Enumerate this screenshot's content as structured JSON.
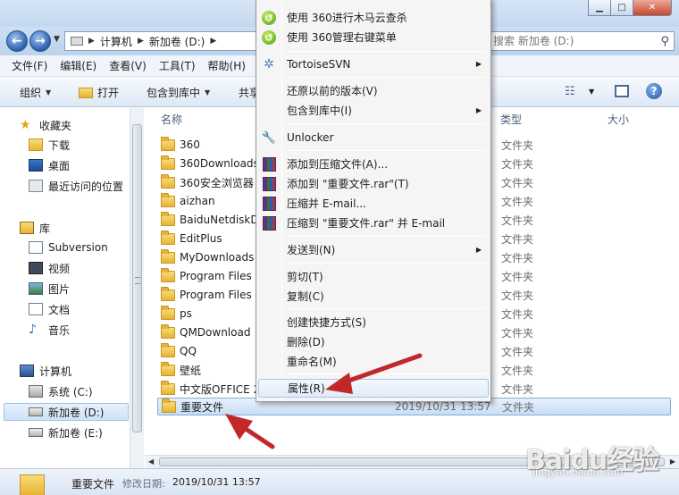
{
  "address": {
    "crumbs": [
      "计算机",
      "新加卷 (D:)"
    ],
    "search_placeholder": "搜索 新加卷 (D:)"
  },
  "menubar": [
    "文件(F)",
    "编辑(E)",
    "查看(V)",
    "工具(T)",
    "帮助(H)"
  ],
  "commandbar": {
    "organize": "组织",
    "open": "打开",
    "include_in_library": "包含到库中",
    "share": "共享"
  },
  "navpane": {
    "favorites": "收藏夹",
    "downloads": "下载",
    "desktop": "桌面",
    "recent": "最近访问的位置",
    "libraries": "库",
    "subversion": "Subversion",
    "videos": "视频",
    "pictures": "图片",
    "documents": "文档",
    "music": "音乐",
    "computer": "计算机",
    "drive_c": "系统 (C:)",
    "drive_d": "新加卷 (D:)",
    "drive_e": "新加卷 (E:)"
  },
  "filelist": {
    "columns": {
      "name": "名称",
      "type": "类型",
      "size": "大小"
    },
    "rows": [
      {
        "name": "360",
        "type": "文件夹"
      },
      {
        "name": "360Downloads",
        "type": "文件夹"
      },
      {
        "name": "360安全浏览器",
        "type": "文件夹"
      },
      {
        "name": "aizhan",
        "type": "文件夹"
      },
      {
        "name": "BaiduNetdiskD",
        "type": "文件夹"
      },
      {
        "name": "EditPlus",
        "type": "文件夹"
      },
      {
        "name": "MyDownloads",
        "type": "文件夹"
      },
      {
        "name": "Program Files",
        "type": "文件夹"
      },
      {
        "name": "Program Files",
        "type": "文件夹"
      },
      {
        "name": "ps",
        "type": "文件夹"
      },
      {
        "name": "QMDownload",
        "type": "文件夹"
      },
      {
        "name": "QQ",
        "type": "文件夹"
      },
      {
        "name": "壁纸",
        "type": "文件夹"
      },
      {
        "name": "中文版OFFICE 2",
        "type": "文件夹"
      },
      {
        "name": "重要文件",
        "date": "2019/10/31 13:57",
        "type": "文件夹"
      }
    ]
  },
  "context_menu": {
    "items": [
      {
        "label": "使用 360进行木马云查杀",
        "icon": "360-icon"
      },
      {
        "label": "使用 360管理右键菜单",
        "icon": "360-icon"
      },
      {
        "label": "TortoiseSVN",
        "icon": "tortoisesvn-icon",
        "submenu": true
      },
      {
        "label": "还原以前的版本(V)"
      },
      {
        "label": "包含到库中(I)",
        "submenu": true
      },
      {
        "label": "Unlocker",
        "icon": "unlocker-icon"
      },
      {
        "label": "添加到压缩文件(A)...",
        "icon": "winrar-icon"
      },
      {
        "label": "添加到 \"重要文件.rar\"(T)",
        "icon": "winrar-icon"
      },
      {
        "label": "压缩并 E-mail...",
        "icon": "winrar-icon"
      },
      {
        "label": "压缩到 \"重要文件.rar\" 并 E-mail",
        "icon": "winrar-icon"
      },
      {
        "label": "发送到(N)",
        "submenu": true
      },
      {
        "label": "剪切(T)"
      },
      {
        "label": "复制(C)"
      },
      {
        "label": "创建快捷方式(S)"
      },
      {
        "label": "删除(D)"
      },
      {
        "label": "重命名(M)"
      },
      {
        "label": "属性(R)"
      }
    ]
  },
  "details": {
    "name": "重要文件",
    "date_label": "修改日期:",
    "date": "2019/10/31 13:57"
  },
  "watermark": {
    "logo": "Baidu经验",
    "url": "jingyan.baidu.com"
  },
  "colors": {
    "annotation_arrow": "#c0282a",
    "selection": "#cfe2f8",
    "folder": "#e7b334"
  }
}
